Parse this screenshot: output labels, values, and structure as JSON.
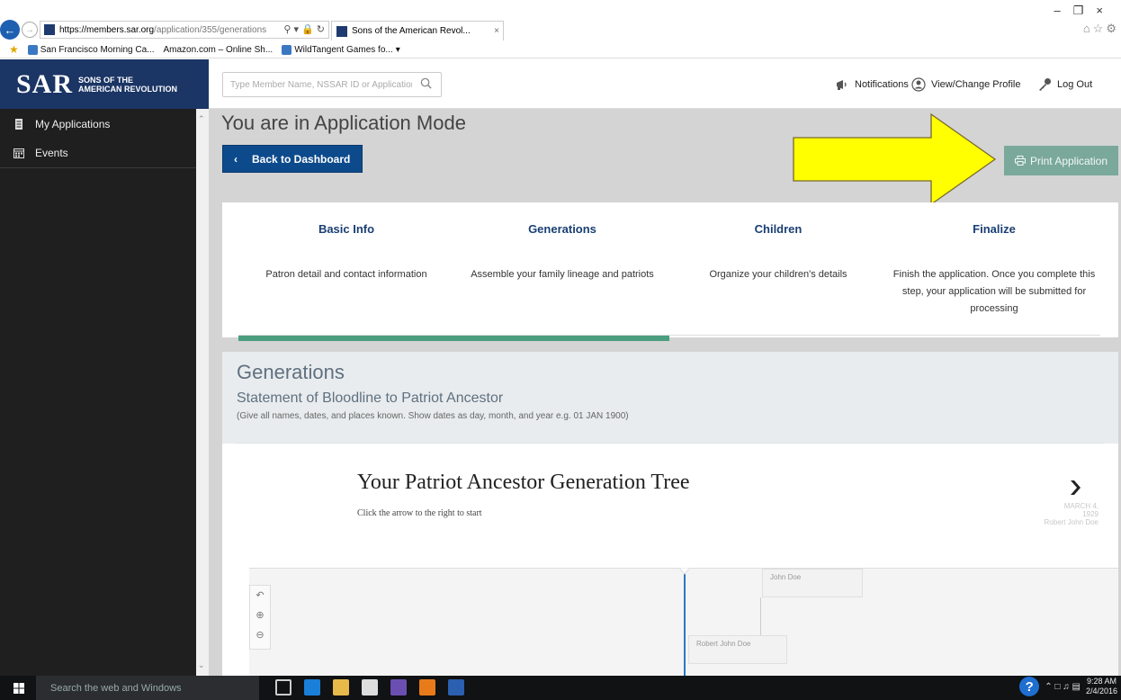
{
  "browser": {
    "url_host": "https://members.sar.org",
    "url_path": "/application/355/generations",
    "tab_title": "Sons of the American Revol...",
    "favorites": [
      "San Francisco Morning Ca...",
      "Amazon.com – Online Sh...",
      "WildTangent Games fo..."
    ]
  },
  "site": {
    "logo_main": "SAR",
    "logo_sub_line1": "SONS OF THE",
    "logo_sub_line2": "AMERICAN REVOLUTION",
    "search_placeholder": "Type Member Name, NSSAR ID or Application ID here",
    "notifications_label": "Notifications",
    "profile_label": "View/Change Profile",
    "logout_label": "Log Out"
  },
  "sidebar": {
    "items": [
      {
        "label": "My Applications",
        "icon": "document-icon"
      },
      {
        "label": "Events",
        "icon": "calendar-icon"
      }
    ]
  },
  "main": {
    "mode_title": "You are in Application Mode",
    "back_label": "Back to Dashboard",
    "print_label": "Print Application",
    "annotation_arrow_color": "#ffff00",
    "steps": [
      {
        "title": "Basic Info",
        "desc": "Patron detail and contact information"
      },
      {
        "title": "Generations",
        "desc": "Assemble your family lineage and patriots"
      },
      {
        "title": "Children",
        "desc": "Organize your children's details"
      },
      {
        "title": "Finalize",
        "desc": "Finish the application. Once you complete this step, your application will be submitted for processing"
      }
    ],
    "progress_fraction": 0.5,
    "generations": {
      "title": "Generations",
      "subtitle": "Statement of Bloodline to Patriot Ancestor",
      "hint": "(Give all names, dates, and places known. Show dates as day, month, and year e.g. 01 JAN 1900)",
      "tree_title": "Your Patriot Ancestor Generation Tree",
      "tree_hint": "Click the arrow to the right to start",
      "date_line1": "MARCH 4,",
      "date_line2": "1929",
      "date_name": "Robert John Doe",
      "person_top": "John Doe",
      "person_bottom": "Robert John Doe"
    }
  },
  "taskbar": {
    "search_placeholder": "Search the web and Windows",
    "time": "9:28 AM",
    "date": "2/4/2016"
  },
  "colors": {
    "brand_navy": "#1b3564",
    "primary_button": "#0d4a8c",
    "print_button": "#7aa89a",
    "progress_green": "#4a9e7f",
    "step_title": "#1a3f73"
  }
}
